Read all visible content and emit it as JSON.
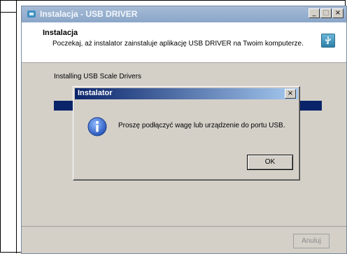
{
  "window": {
    "title": "Instalacja - USB DRIVER",
    "min_label": "_",
    "max_label": "□",
    "close_label": "×"
  },
  "header": {
    "title": "Instalacja",
    "subtitle": "Poczekaj, aż instalator zainstaluje aplikację USB DRIVER na Twoim komputerze."
  },
  "status": {
    "text": "Installing USB Scale Drivers",
    "progress": 1.0
  },
  "footer": {
    "cancel_label": "Anuluj"
  },
  "dialog": {
    "title": "Instalator",
    "close_label": "×",
    "message": "Proszę podłączyć wagę lub urządzenie do portu USB.",
    "ok_label": "OK"
  },
  "colors": {
    "progress_fill": "#0a246a",
    "dialog_title": "#0a246a",
    "info_icon": "#2b63c9"
  }
}
